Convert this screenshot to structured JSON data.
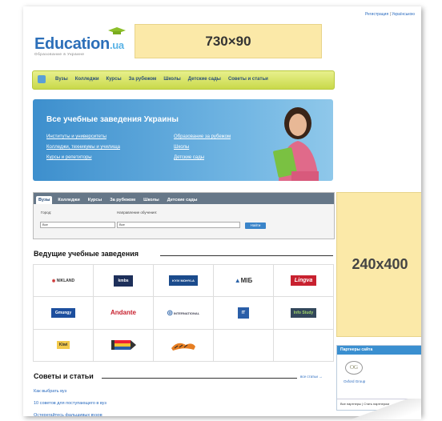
{
  "header": {
    "login_label": "Регистрация",
    "lang_sep": "|",
    "lang_label": "Українською",
    "logo_text": "Education",
    "logo_suffix": ".ua",
    "logo_sub": "Образование в Украине",
    "ad_top": "730×90"
  },
  "nav": {
    "items": [
      "Вузы",
      "Колледжи",
      "Курсы",
      "За рубежом",
      "Школы",
      "Детские сады",
      "Советы и статьи"
    ]
  },
  "banner": {
    "title": "Все учебные заведения Украины",
    "col1": [
      "Институты и университеты",
      "Колледжи, техникумы и училища",
      "Курсы и репетиторы"
    ],
    "col2": [
      "Образование за рубежом",
      "Школы",
      "Детские сады"
    ]
  },
  "search": {
    "tabs": [
      "Вузы",
      "Колледжи",
      "Курсы",
      "За рубежом",
      "Школы",
      "Детские сады"
    ],
    "city_label": "Город:",
    "city_value": "Все",
    "direction_label": "Направление обучения:",
    "direction_value": "Все",
    "button": "Найти"
  },
  "leading": {
    "title": "Ведущие учебные заведения",
    "logos": [
      "NIKLAND",
      "kmbs",
      "KYIV MOHYLA",
      "МІБ",
      "Lingva",
      "Gmungy",
      "Andante",
      "INTERNATIONAL",
      "IT",
      "Info Study",
      "Kiwi",
      "pencil",
      "cat"
    ]
  },
  "ad_side": "240x400",
  "partners": {
    "title": "Партнеры сайта",
    "logo_letters": "OG",
    "name": "Oxford Group",
    "footer_all": "Все партнеры",
    "footer_sep": "|",
    "footer_become": "Стать партнером"
  },
  "advice": {
    "title": "Советы и статьи",
    "all_label": "все статьи →",
    "links": [
      "Как выбрать вуз",
      "10 советов для поступающего в вуз",
      "Остерегайтесь фальшивых вузов"
    ]
  },
  "colors": {
    "accent_blue": "#2c6fb9",
    "nav_green": "#c9d94a",
    "ad_yellow": "#fbe9a8"
  }
}
